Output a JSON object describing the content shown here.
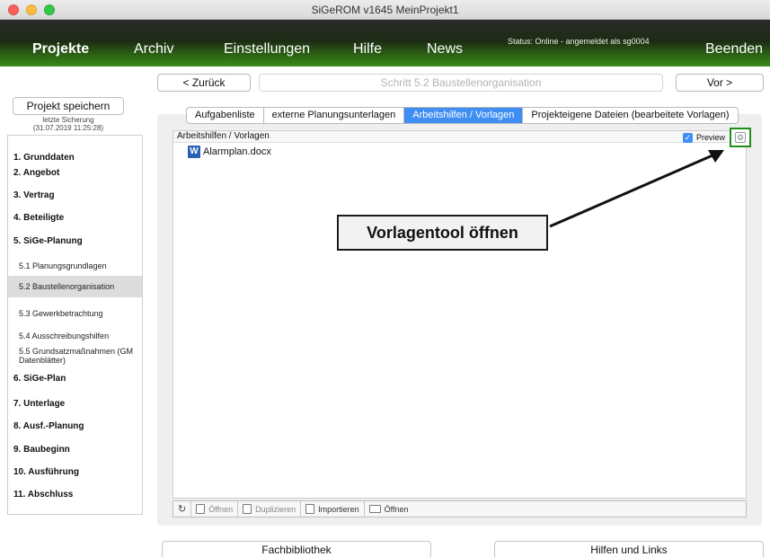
{
  "window": {
    "title": "SiGeROM  v1645   MeinProjekt1"
  },
  "menu": {
    "items": [
      "Projekte",
      "Archiv",
      "Einstellungen",
      "Hilfe",
      "News"
    ],
    "status": "Status: Online - angemeldet als sg0004",
    "quit": "Beenden"
  },
  "step": {
    "back": "< Zurück",
    "title": "Schritt 5.2  Baustellenorganisation",
    "next": "Vor >"
  },
  "sidebar": {
    "save_label": "Projekt speichern",
    "last_save_label": "letzte Sicherung",
    "last_save_time": "(31.07.2019 11:25:28)",
    "items": [
      {
        "label": "1.  Grunddaten"
      },
      {
        "label": "2.  Angebot"
      },
      {
        "label": "3.  Vertrag"
      },
      {
        "label": "4.  Beteiligte"
      },
      {
        "label": "5.  SiGe-Planung"
      },
      {
        "label": "5.1 Planungsgrundlagen"
      },
      {
        "label": "5.2 Baustellenorganisation"
      },
      {
        "label": "5.3 Gewerkbetrachtung"
      },
      {
        "label": "5.4 Ausschreibungshilfen"
      },
      {
        "label": "5.5 Grundsatzmaßnahmen (GM Datenblätter)"
      },
      {
        "label": "6.  SiGe-Plan"
      },
      {
        "label": "7.  Unterlage"
      },
      {
        "label": "8.  Ausf.-Planung"
      },
      {
        "label": "9.  Baubeginn"
      },
      {
        "label": "10. Ausführung"
      },
      {
        "label": "11. Abschluss"
      }
    ]
  },
  "tabs": [
    "Aufgabenliste",
    "externe Planungsunterlagen",
    "Arbeitshilfen / Vorlagen",
    "Projekteigene Dateien (bearbeitete Vorlagen)"
  ],
  "panel": {
    "title": "Arbeitshilfen / Vorlagen",
    "preview_label": "Preview",
    "files": [
      {
        "name": "Alarmplan.docx",
        "icon": "word-icon"
      }
    ]
  },
  "callout": "Vorlagentool öffnen",
  "toolbar": {
    "open1": "Öffnen",
    "duplicate": "Duplizieren",
    "import": "Importieren",
    "open2": "Öffnen"
  },
  "footer": {
    "library": "Fachbibliothek",
    "help": "Hilfen und Links"
  },
  "colors": {
    "accent_blue": "#3f8ef3",
    "highlight_green": "#1f8f1a",
    "word_blue": "#2b5fb4"
  }
}
